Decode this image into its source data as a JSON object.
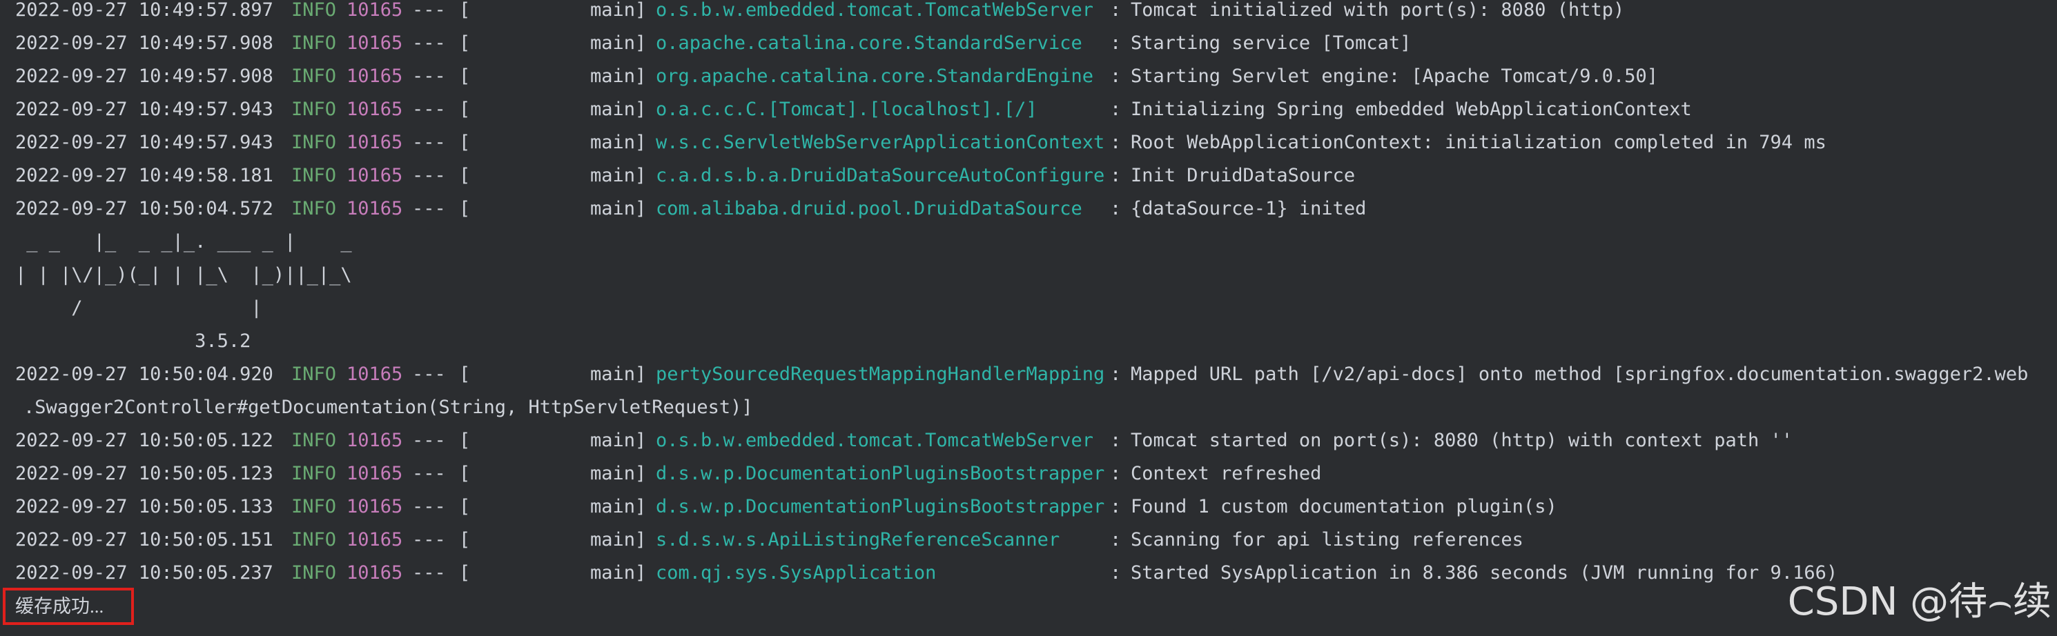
{
  "log_lines": [
    {
      "timestamp": "2022-09-27 10:49:57.897",
      "level": "INFO",
      "pid": "10165",
      "dashes": "---",
      "bracket": "[",
      "thread": "main]",
      "logger": "o.s.b.w.embedded.tomcat.TomcatWebServer",
      "sep": ":",
      "message": "Tomcat initialized with port(s): 8080 (http)"
    },
    {
      "timestamp": "2022-09-27 10:49:57.908",
      "level": "INFO",
      "pid": "10165",
      "dashes": "---",
      "bracket": "[",
      "thread": "main]",
      "logger": "o.apache.catalina.core.StandardService",
      "sep": ":",
      "message": "Starting service [Tomcat]"
    },
    {
      "timestamp": "2022-09-27 10:49:57.908",
      "level": "INFO",
      "pid": "10165",
      "dashes": "---",
      "bracket": "[",
      "thread": "main]",
      "logger": "org.apache.catalina.core.StandardEngine",
      "sep": ":",
      "message": "Starting Servlet engine: [Apache Tomcat/9.0.50]"
    },
    {
      "timestamp": "2022-09-27 10:49:57.943",
      "level": "INFO",
      "pid": "10165",
      "dashes": "---",
      "bracket": "[",
      "thread": "main]",
      "logger": "o.a.c.c.C.[Tomcat].[localhost].[/]",
      "sep": ":",
      "message": "Initializing Spring embedded WebApplicationContext"
    },
    {
      "timestamp": "2022-09-27 10:49:57.943",
      "level": "INFO",
      "pid": "10165",
      "dashes": "---",
      "bracket": "[",
      "thread": "main]",
      "logger": "w.s.c.ServletWebServerApplicationContext",
      "sep": ":",
      "message": "Root WebApplicationContext: initialization completed in 794 ms"
    },
    {
      "timestamp": "2022-09-27 10:49:58.181",
      "level": "INFO",
      "pid": "10165",
      "dashes": "---",
      "bracket": "[",
      "thread": "main]",
      "logger": "c.a.d.s.b.a.DruidDataSourceAutoConfigure",
      "sep": ":",
      "message": "Init DruidDataSource"
    },
    {
      "timestamp": "2022-09-27 10:50:04.572",
      "level": "INFO",
      "pid": "10165",
      "dashes": "---",
      "bracket": "[",
      "thread": "main]",
      "logger": "com.alibaba.druid.pool.DruidDataSource",
      "sep": ":",
      "message": "{dataSource-1} inited"
    }
  ],
  "banner": {
    "line1": " _ _   |_  _ _|_. ___ _ |    _",
    "line2": "| | |\\/|_)(_| | |_\\  |_)||_|_\\",
    "line3": "     /               |",
    "version": "                3.5.2"
  },
  "log_lines_2": [
    {
      "timestamp": "2022-09-27 10:50:04.920",
      "level": "INFO",
      "pid": "10165",
      "dashes": "---",
      "bracket": "[",
      "thread": "main]",
      "logger": "pertySourcedRequestMappingHandlerMapping",
      "sep": ":",
      "message": "Mapped URL path [/v2/api-docs] onto method [springfox.documentation.swagger2.web"
    }
  ],
  "continuation": ".Swagger2Controller#getDocumentation(String, HttpServletRequest)]",
  "log_lines_3": [
    {
      "timestamp": "2022-09-27 10:50:05.122",
      "level": "INFO",
      "pid": "10165",
      "dashes": "---",
      "bracket": "[",
      "thread": "main]",
      "logger": "o.s.b.w.embedded.tomcat.TomcatWebServer",
      "sep": ":",
      "message": "Tomcat started on port(s): 8080 (http) with context path ''"
    },
    {
      "timestamp": "2022-09-27 10:50:05.123",
      "level": "INFO",
      "pid": "10165",
      "dashes": "---",
      "bracket": "[",
      "thread": "main]",
      "logger": "d.s.w.p.DocumentationPluginsBootstrapper",
      "sep": ":",
      "message": "Context refreshed"
    },
    {
      "timestamp": "2022-09-27 10:50:05.133",
      "level": "INFO",
      "pid": "10165",
      "dashes": "---",
      "bracket": "[",
      "thread": "main]",
      "logger": "d.s.w.p.DocumentationPluginsBootstrapper",
      "sep": ":",
      "message": "Found 1 custom documentation plugin(s)"
    },
    {
      "timestamp": "2022-09-27 10:50:05.151",
      "level": "INFO",
      "pid": "10165",
      "dashes": "---",
      "bracket": "[",
      "thread": "main]",
      "logger": "s.d.s.w.s.ApiListingReferenceScanner",
      "sep": ":",
      "message": "Scanning for api listing references"
    },
    {
      "timestamp": "2022-09-27 10:50:05.237",
      "level": "INFO",
      "pid": "10165",
      "dashes": "---",
      "bracket": "[",
      "thread": "main]",
      "logger": "com.qj.sys.SysApplication",
      "sep": ":",
      "message": "Started SysApplication in 8.386 seconds (JVM running for 9.166)"
    }
  ],
  "cache_message": "缓存成功...",
  "watermark": "CSDN @待⌢续",
  "colors": {
    "background": "#2b2d30",
    "text": "#cfd3da",
    "level": "#6aab73",
    "pid": "#c77dbb",
    "logger": "#2fb5a8",
    "highlight_border": "#e0201c"
  }
}
